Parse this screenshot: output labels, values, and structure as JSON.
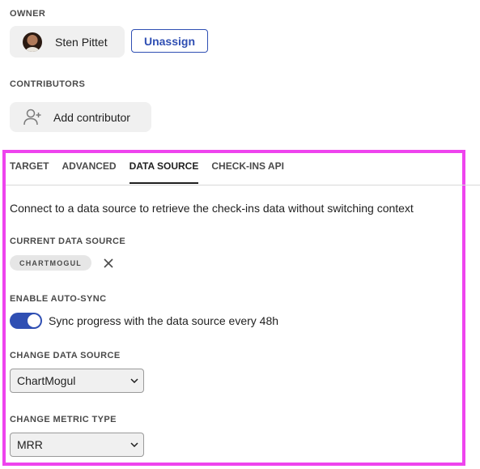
{
  "owner": {
    "section_label": "OWNER",
    "name": "Sten Pittet",
    "unassign_label": "Unassign"
  },
  "contributors": {
    "section_label": "CONTRIBUTORS",
    "add_label": "Add contributor"
  },
  "tabs": [
    {
      "label": "TARGET",
      "active": false
    },
    {
      "label": "ADVANCED",
      "active": false
    },
    {
      "label": "DATA SOURCE",
      "active": true
    },
    {
      "label": "CHECK-INS API",
      "active": false
    }
  ],
  "data_source": {
    "description": "Connect to a data source to retrieve the check-ins data without switching context",
    "current_label": "CURRENT DATA SOURCE",
    "current_value": "CHARTMOGUL",
    "auto_sync_label": "ENABLE AUTO-SYNC",
    "auto_sync_enabled": true,
    "auto_sync_text": "Sync progress with the data source every 48h",
    "change_source_label": "CHANGE DATA SOURCE",
    "change_source_value": "ChartMogul",
    "change_metric_label": "CHANGE METRIC TYPE",
    "change_metric_value": "MRR"
  },
  "icons": {
    "add_contributor": "add-user-icon",
    "remove_source": "close-icon",
    "select_arrow": "chevron-down-icon"
  },
  "colors": {
    "accent": "#2f4fb3",
    "highlight": "#ee44ee",
    "chip_background": "#f0f0f0"
  }
}
